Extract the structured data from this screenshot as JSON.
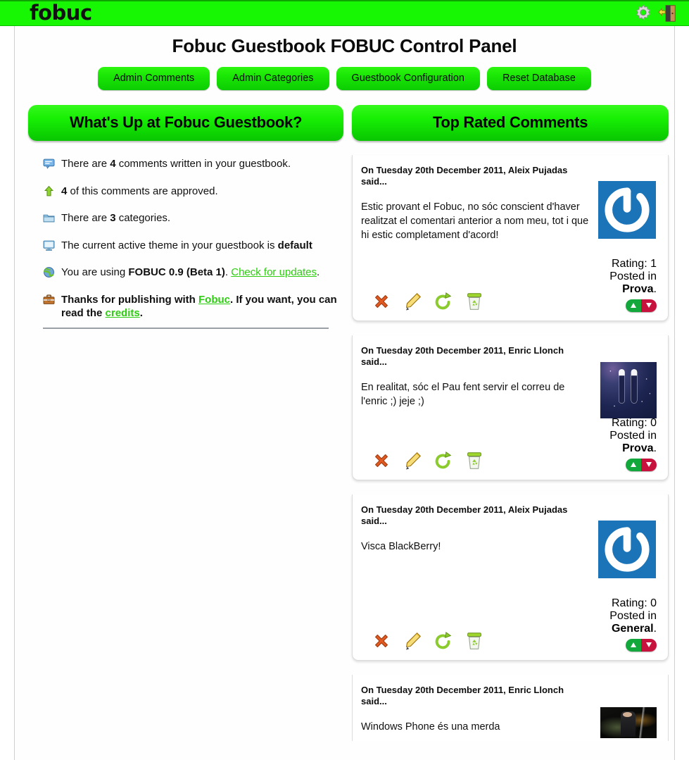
{
  "topbar": {
    "logo_text": "fobuc",
    "icons": [
      {
        "name": "settings-gear-icon",
        "label": "Settings"
      },
      {
        "name": "logout-door-icon",
        "label": "Log out"
      }
    ]
  },
  "page": {
    "title": "Fobuc Guestbook FOBUC Control Panel",
    "nav": [
      {
        "label": "Admin Comments"
      },
      {
        "label": "Admin Categories"
      },
      {
        "label": "Guestbook Configuration"
      },
      {
        "label": "Reset Database"
      }
    ]
  },
  "left_panel": {
    "heading": "What's Up at Fobuc Guestbook?",
    "items": [
      {
        "icon": "comment-bubble-icon",
        "pre": "There are ",
        "strong": "4",
        "post": " comments written in your guestbook."
      },
      {
        "icon": "green-up-arrow-icon",
        "pre": "",
        "strong": "4",
        "post": " of this comments are approved."
      },
      {
        "icon": "folder-icon",
        "pre": "There are ",
        "strong": "3",
        "post": " categories."
      },
      {
        "icon": "monitor-icon",
        "pre": "The current active theme in your guestbook is ",
        "strong": "default",
        "post": ""
      },
      {
        "icon": "globe-icon",
        "pre": "You are using ",
        "strong": "FOBUC 0.9 (Beta 1)",
        "post": ". ",
        "link": "Check for updates",
        "tail": "."
      },
      {
        "icon": "briefcase-icon",
        "bold": true,
        "pre": "Thanks for publishing with ",
        "link": "Fobuc",
        "mid": ". If you want, you can read the ",
        "link2": "credits",
        "tail": "."
      }
    ]
  },
  "right_panel": {
    "heading": "Top Rated Comments",
    "action_icons": [
      {
        "name": "unapprove-cross-icon",
        "title": "Unapprove"
      },
      {
        "name": "edit-pencil-icon",
        "title": "Edit"
      },
      {
        "name": "restore-arrow-icon",
        "title": "Restore"
      },
      {
        "name": "delete-recycle-bin-icon",
        "title": "Delete"
      }
    ],
    "rating_label": "Rating:",
    "posted_label": "Posted in",
    "comments": [
      {
        "head": "On Tuesday 20th December 2011, Aleix Pujadas said...",
        "body": "Estic provant el Fobuc, no sóc conscient d'haver realitzat el comentari anterior a nom meu, tot i que hi estic completament d'acord!",
        "rating": "1",
        "category": "Prova",
        "avatar": "gravatar-blue-logo"
      },
      {
        "head": "On Tuesday 20th December 2011, Enric Llonch said...",
        "body": "En realitat, sóc el Pau fent servir el correu de l'enric ;) jeje ;)",
        "rating": "0",
        "category": "Prova",
        "avatar": "space-bars-avatar"
      },
      {
        "head": "On Tuesday 20th December 2011, Aleix Pujadas said...",
        "body": "Visca BlackBerry!",
        "rating": "0",
        "category": "General",
        "avatar": "gravatar-blue-logo"
      },
      {
        "head": "On Tuesday 20th December 2011, Enric Llonch said...",
        "body": "Windows Phone és una merda",
        "rating": "",
        "category": "",
        "avatar": "dark-photo-avatar"
      }
    ]
  },
  "colors": {
    "brand_green": "#17f603",
    "link_green": "#2ecc12",
    "vote_up": "#12a83c",
    "vote_down": "#c7123e",
    "gravatar_blue": "#1c74b8"
  }
}
